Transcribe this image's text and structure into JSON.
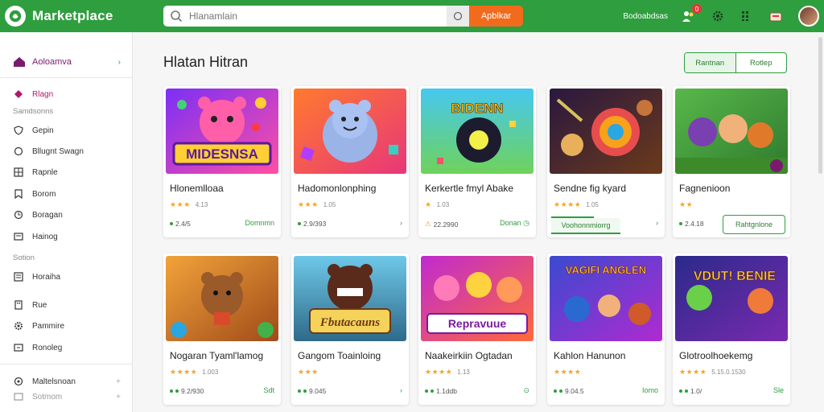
{
  "app": {
    "name": "Marketplace"
  },
  "search": {
    "placeholder": "Hlanamlain",
    "button_label": "Apblkar"
  },
  "topbar": {
    "link_label": "Bodoabdsas",
    "cart_badge": "0"
  },
  "colors": {
    "accent": "#2e9e3e",
    "search_button": "#f26b1d",
    "brand_pink": "#b0186a"
  },
  "sidebar": {
    "header": {
      "label": "Aoloamva",
      "icon": "home-icon"
    },
    "items": [
      {
        "label": "Rlagn",
        "icon": "diamond-icon",
        "active": true
      },
      {
        "label": "Gepin",
        "icon": "shield-icon"
      },
      {
        "label": "Bllugnt Swagn",
        "icon": "circle-icon"
      },
      {
        "label": "Rapnle",
        "icon": "grid-icon"
      },
      {
        "label": "Borom",
        "icon": "bookmark-icon"
      },
      {
        "label": "Boragan",
        "icon": "clock-icon"
      },
      {
        "label": "Hainog",
        "icon": "window-icon"
      },
      {
        "label": "Horaiha",
        "icon": "list-icon"
      },
      {
        "label": "Rue",
        "icon": "building-icon"
      },
      {
        "label": "Pammire",
        "icon": "gear-icon"
      },
      {
        "label": "Ronoleg",
        "icon": "box-icon"
      },
      {
        "label": "Maltelsnoan",
        "icon": "settings-icon"
      },
      {
        "label": "Sotmom",
        "icon": "people-icon"
      }
    ],
    "sections": {
      "first": "Samdsonns",
      "second": "Sotion"
    }
  },
  "main": {
    "title": "Hlatan Hitran",
    "tabs": [
      {
        "label": "Rantnan",
        "active": true
      },
      {
        "label": "Rotlep"
      }
    ]
  },
  "cards": [
    {
      "title": "Hlonemlloaa",
      "stars": "★★★",
      "rating": "4.13",
      "meta": "2.4/5",
      "action": "Domnmn",
      "art_text": "MIDESNSA"
    },
    {
      "title": "Hadomonlonphing",
      "stars": "★★★",
      "rating": "1.05",
      "meta": "2.9/393",
      "action": "›"
    },
    {
      "title": "Kerkertle fmyl Abake",
      "stars": "★",
      "rating": "1.03",
      "meta": "22.2990",
      "action": "Donan",
      "art_text": "BIDENN"
    },
    {
      "title": "Sendne fig kyard",
      "stars": "★★★★",
      "rating": "1.05",
      "meta": "",
      "action": "›",
      "progress_label": "Voohonnmiorrg",
      "progress": 0.62
    },
    {
      "title": "Fagnenioon",
      "stars": "★★",
      "rating": "",
      "meta": "2.4.18",
      "action_button": "Rahtgnlone"
    },
    {
      "title": "Nogaran Tyaml'lamog",
      "stars": "★★★★",
      "rating": "1.003",
      "meta": "9.2/930",
      "action": "Sdt"
    },
    {
      "title": "Gangom Toainloing",
      "stars": "★★★",
      "rating": "",
      "meta": "9.045",
      "action": "›",
      "art_text": "Fbutacauns"
    },
    {
      "title": "Naakeirkiin Ogtadan",
      "stars": "★★★★",
      "rating": "1.13",
      "meta": "1.1ddb",
      "action": "⊙",
      "art_text": "Repravuue"
    },
    {
      "title": "Kahlon Hanunon",
      "stars": "★★★★",
      "rating": "",
      "meta": "9.04.5",
      "action": "Iomo",
      "art_text": "VAGIFI ANGLEN"
    },
    {
      "title": "Glotroolhoekemg",
      "stars": "★★★★",
      "rating": "",
      "rating_line": "5.15.0.1530",
      "meta": "1.0/",
      "action": "Sle",
      "art_text": "VDUT! BENIE"
    }
  ]
}
